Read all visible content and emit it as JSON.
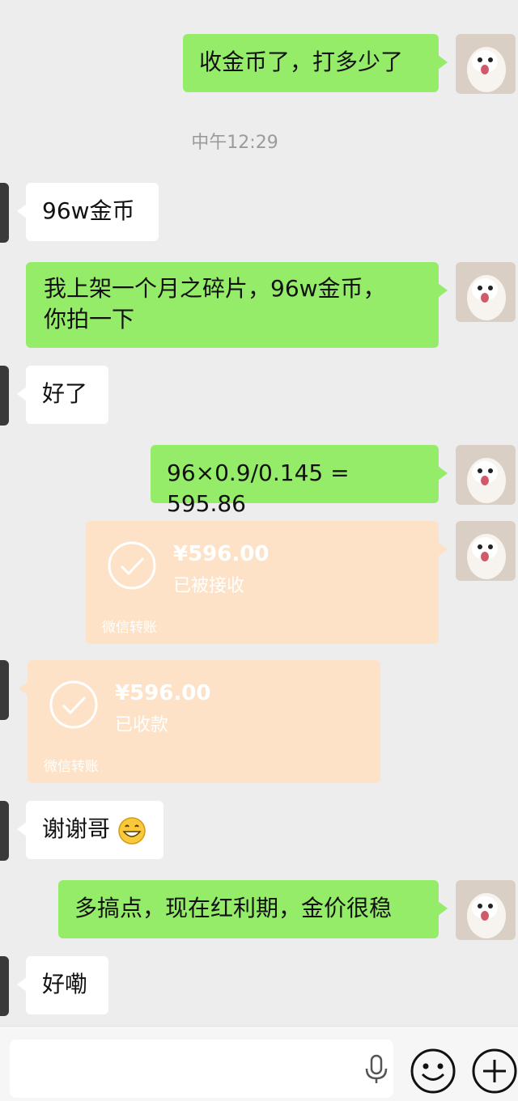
{
  "timestamp": "中午12:29",
  "messages": [
    {
      "text": "收金币了，打多少了"
    },
    {
      "text": "96w金币"
    },
    {
      "line1": "我上架一个月之碎片，96w金币，",
      "line2": "你拍一下"
    },
    {
      "text": "好了"
    },
    {
      "text": "96×0.9/0.145 = 595.86"
    },
    {
      "text": "谢谢哥"
    },
    {
      "text": "多搞点，现在红利期，金价很稳"
    },
    {
      "text": "好嘞"
    }
  ],
  "transfers": [
    {
      "amount": "¥596.00",
      "status": "已被接收",
      "source": "微信转账"
    },
    {
      "amount": "¥596.00",
      "status": "已收款",
      "source": "微信转账"
    }
  ],
  "input": {
    "placeholder": ""
  },
  "colors": {
    "background": "#ededed",
    "outgoing_bubble": "#95ec69",
    "incoming_bubble": "#ffffff",
    "transfer_card": "#fde2c7"
  },
  "icons": [
    "dog-avatar",
    "grin-emoji-icon",
    "mic-icon",
    "emoji-icon",
    "plus-icon"
  ]
}
